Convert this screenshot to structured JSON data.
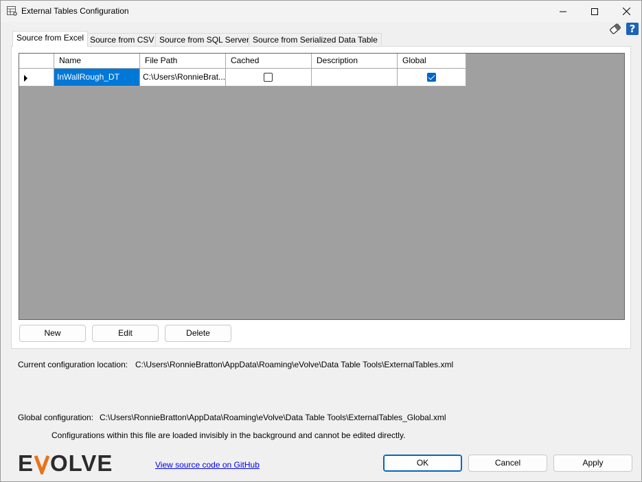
{
  "window": {
    "title": "External Tables Configuration",
    "controls": {
      "minimize": "minimize",
      "maximize": "maximize",
      "close": "close"
    }
  },
  "tabs": [
    {
      "label": "Source from Excel",
      "active": true
    },
    {
      "label": "Source from CSV",
      "active": false
    },
    {
      "label": "Source from SQL Server",
      "active": false
    },
    {
      "label": "Source from Serialized Data Table",
      "active": false
    }
  ],
  "grid": {
    "columns": [
      "Name",
      "File Path",
      "Cached",
      "Description",
      "Global"
    ],
    "rows": [
      {
        "name": "InWallRough_DT",
        "file_path": "C:\\Users\\RonnieBrat...",
        "cached": false,
        "description": "",
        "global": true
      }
    ]
  },
  "actions": {
    "new": "New",
    "edit": "Edit",
    "delete": "Delete"
  },
  "config": {
    "current_label": "Current  configuration location:",
    "current_path": "C:\\Users\\RonnieBratton\\AppData\\Roaming\\eVolve\\Data Table Tools\\ExternalTables.xml",
    "global_label": "Global  configuration:",
    "global_path": "C:\\Users\\RonnieBratton\\AppData\\Roaming\\eVolve\\Data Table Tools\\ExternalTables_Global.xml",
    "global_note": "Configurations within this file are loaded invisibly in the background and cannot be edited directly."
  },
  "footer": {
    "logo_text": "EVOLVE",
    "github_link": "View source code on GitHub",
    "ok": "OK",
    "cancel": "Cancel",
    "apply": "Apply"
  },
  "colors": {
    "accent": "#0078d7",
    "grid_bg": "#a0a0a0",
    "logo_accent": "#e8731a",
    "help_bg": "#1d62b8"
  },
  "icons": {
    "app": "table-settings-icon",
    "settings": "eraser-icon",
    "help": "help-icon"
  }
}
